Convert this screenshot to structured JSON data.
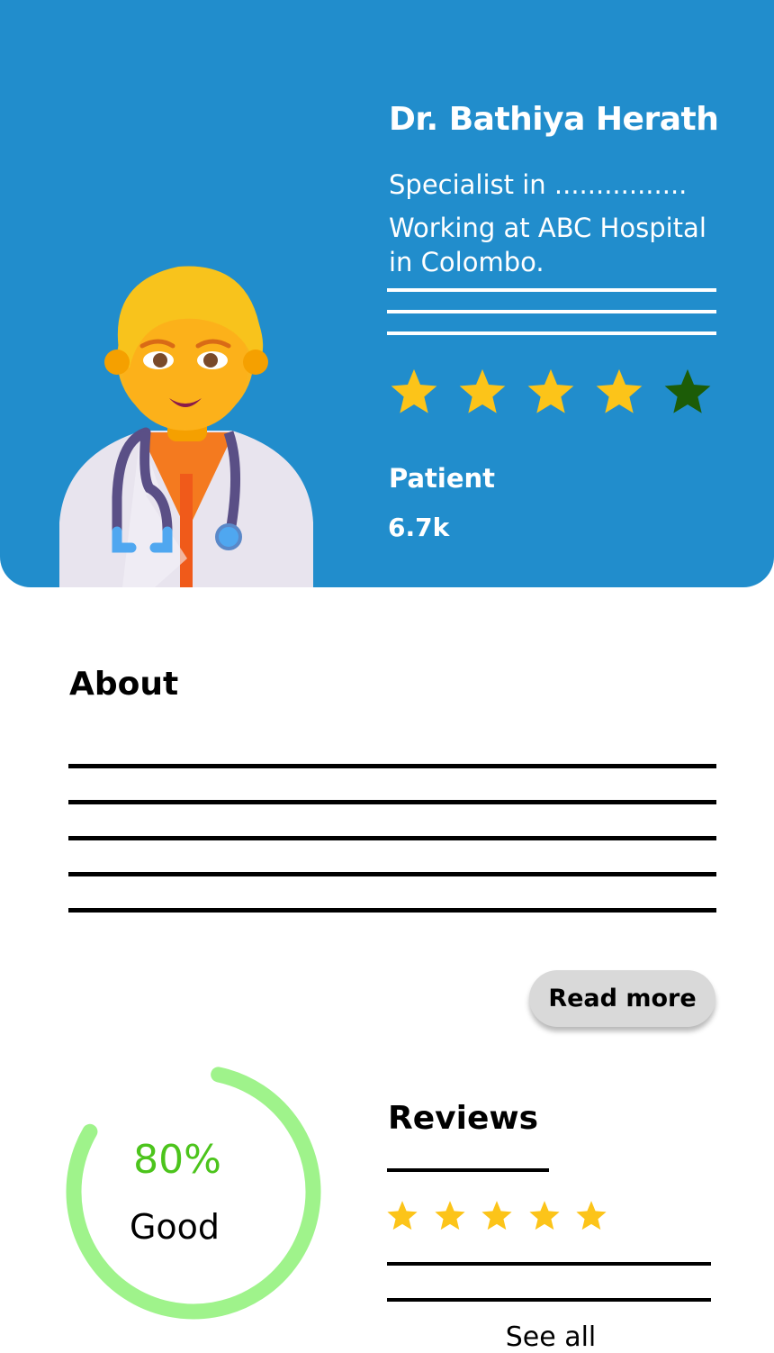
{
  "doctor": {
    "name": "Dr. Bathiya Herath",
    "specialty": "Specialist in ................",
    "workplace_line1": "Working at ABC Hospital",
    "workplace_line2": "in Colombo.",
    "avatar_icon": "doctor-emoji-icon",
    "rating": {
      "value": 4,
      "max": 5,
      "filled_color": "#fcc419",
      "empty_color": "#1c5c07"
    },
    "patient_label": "Patient",
    "patient_count": "6.7k"
  },
  "colors": {
    "header_bg": "#218dcc",
    "ring_color": "#9ff38b",
    "percent_color": "#4cc41c",
    "button_bg": "#d9d9d9"
  },
  "about": {
    "title": "About",
    "read_more_label": "Read more"
  },
  "score": {
    "percent_value": 0.8,
    "percent_text": "80%",
    "label": "Good"
  },
  "reviews": {
    "title": "Reviews",
    "rating": {
      "value": 5,
      "max": 5
    },
    "see_all_label": "See all"
  }
}
